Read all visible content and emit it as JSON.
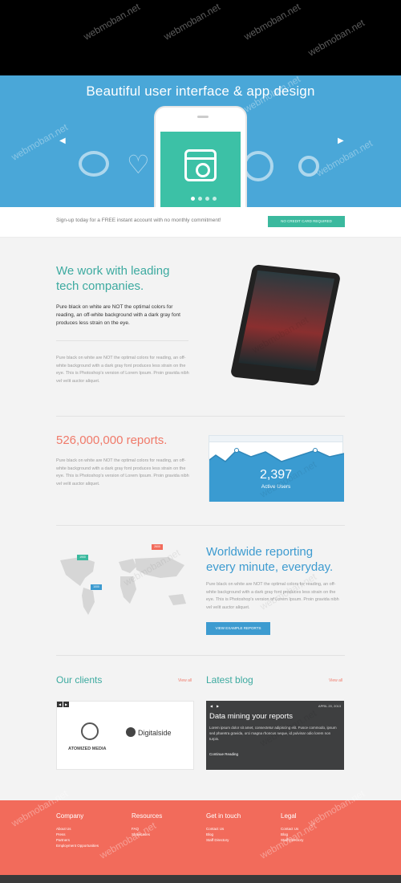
{
  "hero": {
    "title": "Beautiful user interface & app design",
    "prev_arrow": "◀",
    "next_arrow": "▶"
  },
  "signup": {
    "text": "Sign-up today for a FREE instant account with no monthly commitment!",
    "button_label": "NO CREDIT CARD REQUIRED"
  },
  "section_tech": {
    "heading_line1": "We work with leading",
    "heading_line2": "tech companies.",
    "lead": "Pure black on white are NOT the optimal colors for reading, an off-white background with a dark gray font produces less strain on the eye.",
    "body": "Pure black on white are NOT the optimal colors for reading, an off-white background with a dark gray font produces less strain on the eye. This is Photoshop's version of Lorem Ipsum. Proin gravida nibh vel velit auctor aliquet."
  },
  "section_reports": {
    "heading": "526,000,000 reports.",
    "body": "Pure black on white are NOT the optimal colors for reading, an off-white background with a dark gray font produces less strain on the eye. This is Photoshop's version of Lorem Ipsum. Proin gravida nibh vel velit auctor aliquet.",
    "stat_value": "2,397",
    "stat_label": "Active Users"
  },
  "section_world": {
    "heading_line1": "Worldwide reporting",
    "heading_line2": "every minute, everyday.",
    "body": "Pure black on white are NOT the optimal colors for reading, an off-white background with a dark gray font produces less strain on the eye. This is Photoshop's version of Lorem Ipsum. Proin gravida nibh vel velit auctor aliquet.",
    "button_label": "VIEW EXAMPLE REPORTS",
    "pins": [
      "1900",
      "1000",
      "2600"
    ]
  },
  "clients": {
    "heading": "Our clients",
    "view_all": "View all",
    "logo1": "ATOMIZED MEDIA",
    "logo2": "Digitalside"
  },
  "blog": {
    "heading": "Latest blog",
    "view_all": "View all",
    "date": "APRIL 20, 2013",
    "post_title": "Data mining your reports",
    "excerpt": "Lorem ipsum dolor sit amet, consectetur adipiscing elit. Fusce commodo, ipsum sed pharetra gravida, orci magna rhoncus neque, id pulvinar odio lorem non turpis.",
    "read_more": "Continue Reading"
  },
  "footer": {
    "columns": [
      {
        "title": "Company",
        "links": [
          "About Us",
          "Press",
          "Partners",
          "Employment Opportunities"
        ]
      },
      {
        "title": "Resources",
        "links": [
          "FAQ",
          "Showcases"
        ]
      },
      {
        "title": "Get in touch",
        "links": [
          "Contact Us",
          "Blog",
          "Staff Directory"
        ]
      },
      {
        "title": "Legal",
        "links": [
          "Contact Us",
          "Blog",
          "Staff Directory"
        ]
      }
    ]
  },
  "watermark": "webmoban.net",
  "colors": {
    "hero": "#4aa7d8",
    "teal": "#3daaa0",
    "coral": "#f26b5b",
    "blue": "#3d9bd0"
  }
}
